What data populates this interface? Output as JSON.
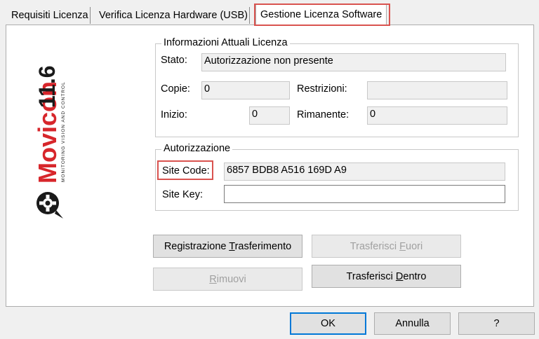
{
  "tabs": [
    {
      "label": "Requisiti Licenza"
    },
    {
      "label": "Verifica Licenza Hardware (USB)"
    },
    {
      "label": "Gestione Licenza Software"
    }
  ],
  "logo": {
    "brand": "Movicon",
    "version": "11.6",
    "tagline": "MONITORING VISION AND CONTROL"
  },
  "info": {
    "title": "Informazioni Attuali Licenza",
    "stato_label": "Stato:",
    "stato_value": "Autorizzazione non presente",
    "copie_label": "Copie:",
    "copie_value": "0",
    "restrizioni_label": "Restrizioni:",
    "restrizioni_value": "",
    "inizio_label": "Inizio:",
    "inizio_value": "0",
    "rimanente_label": "Rimanente:",
    "rimanente_value": "0"
  },
  "auth": {
    "title": "Autorizzazione",
    "site_code_label": "Site Code:",
    "site_code_value": "6857 BDB8 A516 169D A9",
    "site_key_label": "Site Key:",
    "site_key_value": ""
  },
  "buttons": {
    "registrazione": {
      "pre": "Registrazione ",
      "u": "T",
      "post": "rasferimento"
    },
    "trasferisci_fuori": {
      "pre": "Trasferisci ",
      "u": "F",
      "post": "uori"
    },
    "rimuovi": {
      "pre": "",
      "u": "R",
      "post": "imuovi"
    },
    "trasferisci_dentro": {
      "pre": "Trasferisci ",
      "u": "D",
      "post": "entro"
    }
  },
  "dialog": {
    "ok": "OK",
    "annulla": "Annulla",
    "help": "?"
  },
  "colors": {
    "highlight": "#d9534f",
    "brand_red": "#d7262b",
    "brand_dark": "#1a1a1a"
  }
}
